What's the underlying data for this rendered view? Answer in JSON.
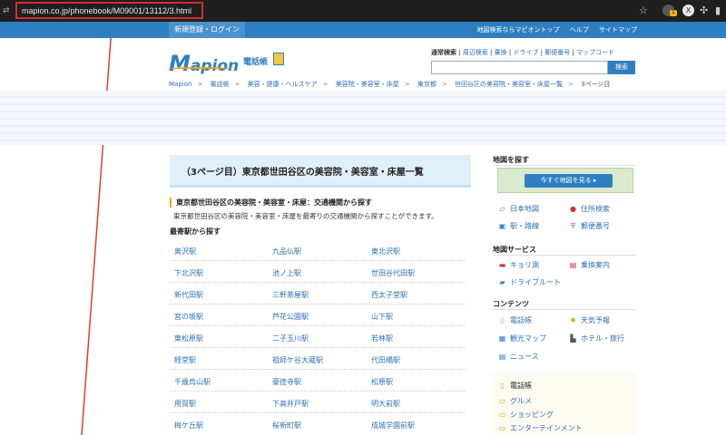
{
  "browser": {
    "url": "mapion.co.jp/phonebook/M09001/13112/3.html",
    "ext_badge": "1",
    "ext2_label": "X"
  },
  "nav": {
    "login": "新規登録・ログイン",
    "right_links": [
      "地図検索ならマピオントップ",
      "ヘルプ",
      "サイトマップ"
    ]
  },
  "header": {
    "logo_m": "M",
    "logo_rest": "apion",
    "logo_sub": "電話帳",
    "search_links": [
      "通常検索",
      "周辺検索",
      "乗換",
      "ドライブ",
      "郵便番号",
      "マップコード"
    ],
    "search_button": "検索",
    "search_placeholder": ""
  },
  "breadcrumb": [
    "Mapion",
    "電話帳",
    "美容・健康・ヘルスケア",
    "美容院・美容室・床屋",
    "東京都",
    "世田谷区の美容院・美容室・床屋一覧",
    "3ページ目"
  ],
  "main": {
    "title": "（3ページ目）東京都世田谷区の美容院・美容室・床屋一覧",
    "section_head": "東京都世田谷区の美容院・美容室・床屋：交通機関から探す",
    "section_desc": "東京都世田谷区の美容院・美容室・床屋を最寄りの交通機関から探すことができます。",
    "station_head": "最寄駅から探す",
    "stations": [
      [
        "奥沢駅",
        "九品仏駅",
        "東北沢駅"
      ],
      [
        "下北沢駅",
        "池ノ上駅",
        "世田谷代田駅"
      ],
      [
        "新代田駅",
        "三軒茶屋駅",
        "西太子堂駅"
      ],
      [
        "宮の坂駅",
        "芦花公園駅",
        "山下駅"
      ],
      [
        "東松原駅",
        "二子玉川駅",
        "若林駅"
      ],
      [
        "経堂駅",
        "祖師ケ谷大蔵駅",
        "代田橋駅"
      ],
      [
        "千歳烏山駅",
        "豪徳寺駅",
        "松原駅"
      ],
      [
        "用賀駅",
        "下高井戸駅",
        "明大前駅"
      ],
      [
        "梅ケ丘駅",
        "桜新町駅",
        "成城学園前駅"
      ]
    ]
  },
  "sidebar": {
    "map_head": "地図を探す",
    "map_banner": "今すぐ地図を見る",
    "map_items": [
      "日本地図",
      "住所検索",
      "駅・路線",
      "郵便番号"
    ],
    "service_head": "地図サービス",
    "service_items": [
      "キョリ測",
      "乗換案内",
      "ドライブルート"
    ],
    "contents_head": "コンテンツ",
    "contents_items": [
      "電話帳",
      "天気予報",
      "観光マップ",
      "ホテル・旅行",
      "ニュース"
    ],
    "phonebook_head": "電話帳",
    "phonebook_items": [
      "グルメ",
      "ショッピング",
      "エンターテインメント"
    ]
  }
}
